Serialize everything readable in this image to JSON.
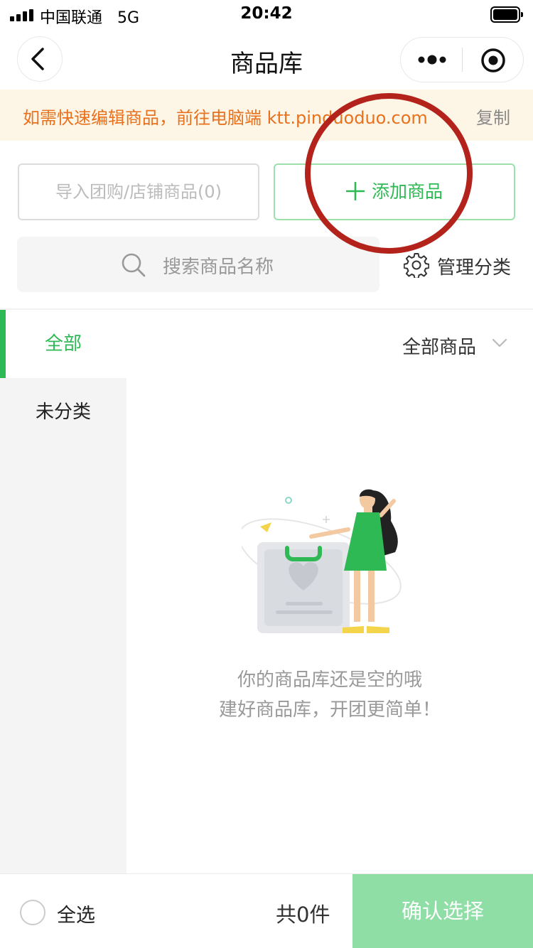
{
  "status_bar": {
    "carrier": "中国联通",
    "network": "5G",
    "time": "20:42"
  },
  "nav": {
    "title": "商品库",
    "back_icon": "chevron-left-icon",
    "more_icon": "more-dots-icon",
    "close_icon": "target-circle-icon"
  },
  "banner": {
    "text": "如需快速编辑商品，前往电脑端 ktt.pinduoduo.com",
    "copy_label": "复制",
    "color": "#e8711d",
    "background": "#fdf5e6"
  },
  "actions": {
    "import_label": "导入团购/店铺商品(0)",
    "add_label": "添加商品",
    "accent_color": "#2fb955"
  },
  "search": {
    "placeholder": "搜索商品名称",
    "manage_label": "管理分类"
  },
  "sidebar": {
    "items": [
      {
        "label": "全部"
      },
      {
        "label": "未分类"
      }
    ]
  },
  "filter": {
    "selected": "全部商品"
  },
  "empty": {
    "line1": "你的商品库还是空的哦",
    "line2": "建好商品库，开团更简单！"
  },
  "bottom": {
    "select_all_label": "全选",
    "count_label": "共0件",
    "confirm_label": "确认选择",
    "confirm_color": "#8edea6"
  },
  "annotation_color": "#b3231c"
}
